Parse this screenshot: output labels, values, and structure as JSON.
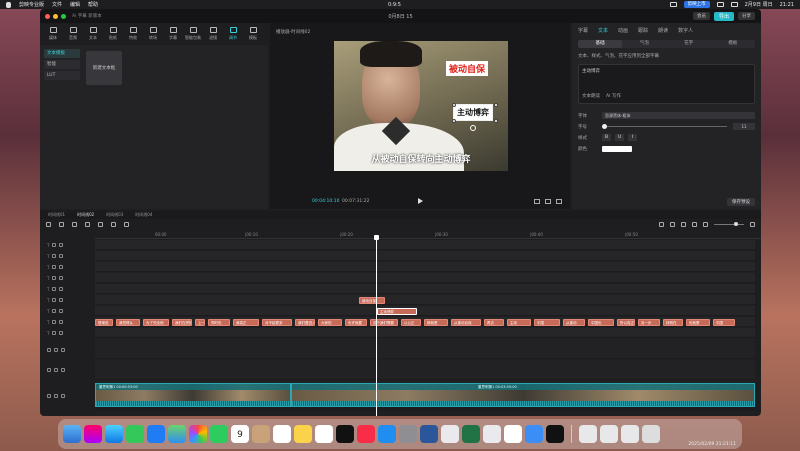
{
  "menubar": {
    "app_name": "剪映专业版",
    "menus": [
      "文件",
      "编辑",
      "帮助"
    ],
    "center_time": "0:9:5",
    "right_items": [
      "剪映上市",
      "2月9日 周日",
      "21:21"
    ],
    "blue_label": "剪映上市"
  },
  "window": {
    "title": "0月8日 15",
    "subtitle": "Ai 字幕 新版本",
    "export_label": "导出",
    "share_label": "分享",
    "vip_label": "会员"
  },
  "toolstrip": [
    {
      "label": "媒体",
      "icon": "media-icon"
    },
    {
      "label": "音频",
      "icon": "audio-icon"
    },
    {
      "label": "文本",
      "icon": "text-icon"
    },
    {
      "label": "贴纸",
      "icon": "sticker-icon"
    },
    {
      "label": "特效",
      "icon": "effects-icon"
    },
    {
      "label": "转场",
      "icon": "transition-icon"
    },
    {
      "label": "字幕",
      "icon": "caption-icon"
    },
    {
      "label": "智能包装",
      "icon": "smart-pack-icon"
    },
    {
      "label": "滤镜",
      "icon": "filter-icon"
    },
    {
      "label": "调节",
      "icon": "adjust-icon"
    },
    {
      "label": "模板",
      "icon": "template-icon"
    }
  ],
  "left_panel": {
    "categories": [
      "文本模板",
      "智能",
      "LUT"
    ],
    "card_label": "新建文本框"
  },
  "player": {
    "title": "播放器-时间线02",
    "caption_red": "被动自保",
    "caption_black": "主动博弈",
    "subtitle": "从被动自保转向主动博弈",
    "time_current": "00:04:10:10",
    "time_total": "00:07:31:22"
  },
  "right_panel": {
    "tabs": [
      "字幕",
      "文本",
      "动画",
      "跟踪",
      "朗读",
      "数字人"
    ],
    "active_tab": "文本",
    "subtabs": [
      "基础",
      "气泡",
      "花字",
      "模板"
    ],
    "active_subtab": "基础",
    "option_line": "文本、样式、气泡、花字应用到全部字幕",
    "textbox_value": "主动博弈",
    "textbox_opts": [
      "文本朗读",
      "AI 写作"
    ],
    "font_label": "字体",
    "font_value": "思源黑体-粗体",
    "size_label": "字号",
    "size_value": "11",
    "style_label": "样式",
    "style_buttons": [
      "B",
      "U",
      "I"
    ],
    "color_label": "颜色",
    "save_preset": "保存预设"
  },
  "timeline": {
    "tabs": [
      "时间线01",
      "时间线02",
      "时间线03",
      "时间线04"
    ],
    "ruler": [
      "00:00",
      "|00:10",
      "|00:20",
      "|00:30",
      "|00:40",
      "|00:50"
    ],
    "red_clip_1": "被动自保",
    "red_clip_2": "主动博弈",
    "caption_clips": [
      "很难说",
      "我觉得从",
      "为了完全他",
      "我们在拼的",
      "上一层",
      "同时也",
      "我真正",
      "对不起更多",
      "我们要进入新的",
      "大家的",
      "也许就要",
      "这个我们需要",
      "以公正",
      "那就是",
      "从被动自保",
      "再去",
      "主动",
      "中国",
      "从被动",
      "中国也",
      "所以真正",
      "另一步",
      "特别在",
      "也就是",
      "中国"
    ],
    "video_clip_1": "董思明第1 00:00:53:00",
    "video_clip_2": "董思明第1 00:03:55:00"
  },
  "dock": {
    "clock": "2025/02/09 21:21:11",
    "calendar_day": "9"
  }
}
